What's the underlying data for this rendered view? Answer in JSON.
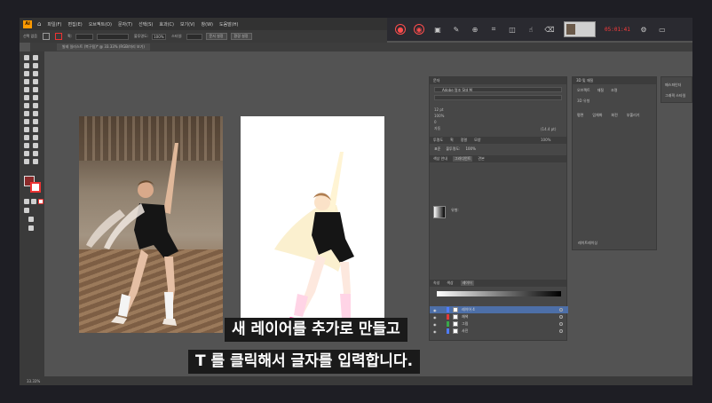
{
  "app": {
    "logo": "Ai",
    "menu": [
      "파일(F)",
      "편집(E)",
      "오브젝트(O)",
      "문자(T)",
      "선택(S)",
      "효과(C)",
      "보기(V)",
      "창(W)",
      "도움말(H)"
    ]
  },
  "recorder": {
    "time": "05:01:41",
    "record_color": "#ff3b3b"
  },
  "control_bar": {
    "selection": "선택 없음",
    "stroke_label": "획:",
    "opacity_label": "불투명도:",
    "opacity_value": "100%",
    "style_label": "스타일:",
    "doc_setup": "문서 설정",
    "preferences": "환경 설정"
  },
  "document_tab": {
    "title": "발레 일러스트 (복구됨)* @ 33.33% (RGB/미리 보기)"
  },
  "character_panel": {
    "title": "문자",
    "font": "Adobe 명조 Std M",
    "size": "12 pt",
    "leading": "(14.4 pt)",
    "scale_v": "100%",
    "scale_h": "100%",
    "tracking": "0",
    "kerning": "자동"
  },
  "appearance_tabs": [
    "투명도",
    "획",
    "정렬",
    "모양"
  ],
  "opacity_row": {
    "mode": "표준",
    "label": "불투명도:",
    "value": "100%"
  },
  "gradient_panel": {
    "tabs": [
      "색상 안내",
      "그라디언트",
      "견본"
    ],
    "type_label": "유형:"
  },
  "layers_panel": {
    "tabs": [
      "속성",
      "색상",
      "레이어"
    ],
    "rows": [
      {
        "name": "레이어 4",
        "color": "#4f7cff"
      },
      {
        "name": "채색",
        "color": "#e23a3a"
      },
      {
        "name": "그림",
        "color": "#3aa84a"
      },
      {
        "name": "사진",
        "color": "#4f7cff"
      }
    ]
  },
  "right_panel": {
    "title": "3D 및 재질",
    "tabs": [
      "오브젝트",
      "재질",
      "조명"
    ],
    "section_label": "3D 유형",
    "types": [
      "평면",
      "입체화",
      "회전",
      "부풀리기"
    ],
    "bottom_label": "레이트레이싱",
    "side_items": [
      "패스파인더",
      "그래픽 스타일"
    ]
  },
  "status_bar": {
    "zoom": "33.33%"
  },
  "subtitles": {
    "line1": "새 레이어를 추가로 만들고",
    "line2": "T 를 클릭해서 글자를 입력합니다."
  }
}
